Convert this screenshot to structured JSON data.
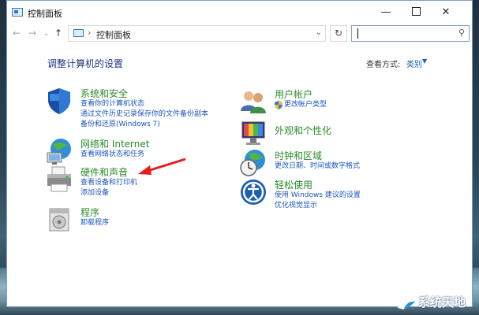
{
  "window": {
    "title": "控制面板"
  },
  "controls": {
    "minimize": "—",
    "close": "✕"
  },
  "nav": {
    "back": "←",
    "forward": "→",
    "dropdown": "⌄",
    "up": "↑",
    "refresh": "↻",
    "dd": "⌄",
    "search_icon": "⚲"
  },
  "address": {
    "separator": "›",
    "path": "控制面板"
  },
  "content": {
    "heading": "调整计算机的设置",
    "view_by_label": "查看方式:",
    "view_by_value": "类别",
    "view_by_arrow": "▼"
  },
  "left_categories": [
    {
      "title": "系统和安全",
      "icon": "shield-icon",
      "links": [
        "查看你的计算机状态",
        "通过文件历史记录保存你的文件备份副本",
        "备份和还原(Windows 7)"
      ]
    },
    {
      "title": "网络和 Internet",
      "icon": "network-globe-icon",
      "links": [
        "查看网络状态和任务"
      ]
    },
    {
      "title": "硬件和声音",
      "icon": "printer-icon",
      "links": [
        "查看设备和打印机",
        "添加设备"
      ]
    },
    {
      "title": "程序",
      "icon": "programs-icon",
      "links": [
        "卸载程序"
      ]
    }
  ],
  "right_categories": [
    {
      "title": "用户帐户",
      "icon": "users-icon",
      "links": [
        "更改帐户类型"
      ]
    },
    {
      "title": "外观和个性化",
      "icon": "appearance-icon",
      "links": []
    },
    {
      "title": "时钟和区域",
      "icon": "clock-globe-icon",
      "links": [
        "更改日期、时间或数字格式"
      ]
    },
    {
      "title": "轻松使用",
      "icon": "ease-of-access-icon",
      "links": [
        "使用 Windows 建议的设置",
        "优化视觉显示"
      ]
    }
  ],
  "watermark": {
    "text": "系统天地"
  }
}
